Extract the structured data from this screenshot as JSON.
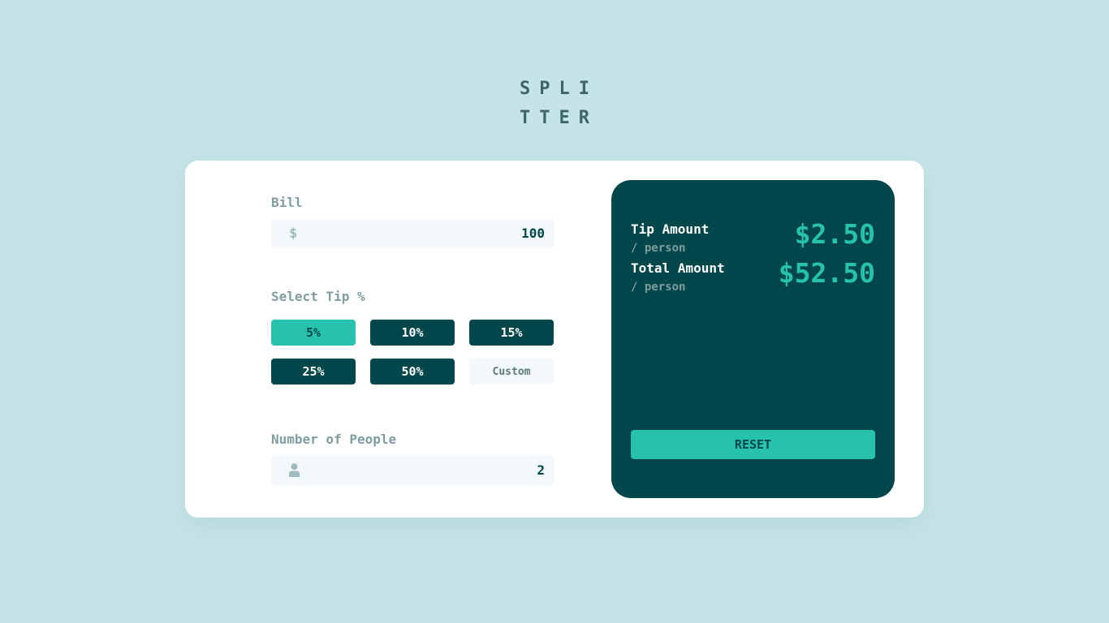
{
  "logo": {
    "line1": "SPLI",
    "line2": "TTER"
  },
  "bill": {
    "label": "Bill",
    "icon": "dollar-icon",
    "icon_glyph": "$",
    "value": "100"
  },
  "tip": {
    "label": "Select Tip %",
    "options": [
      {
        "label": "5%",
        "active": true
      },
      {
        "label": "10%",
        "active": false
      },
      {
        "label": "15%",
        "active": false
      },
      {
        "label": "25%",
        "active": false
      },
      {
        "label": "50%",
        "active": false
      }
    ],
    "custom_placeholder": "Custom"
  },
  "people": {
    "label": "Number of People",
    "icon": "person-icon",
    "value": "2"
  },
  "results": {
    "tip": {
      "title": "Tip Amount",
      "sub": "/ person",
      "value": "$2.50"
    },
    "total": {
      "title": "Total Amount",
      "sub": "/ person",
      "value": "$52.50"
    },
    "reset_label": "RESET"
  },
  "colors": {
    "background": "#c5e4e7",
    "dark_cyan": "#00474b",
    "strong_cyan": "#26c2ae",
    "input_bg": "#f3f8fb"
  }
}
